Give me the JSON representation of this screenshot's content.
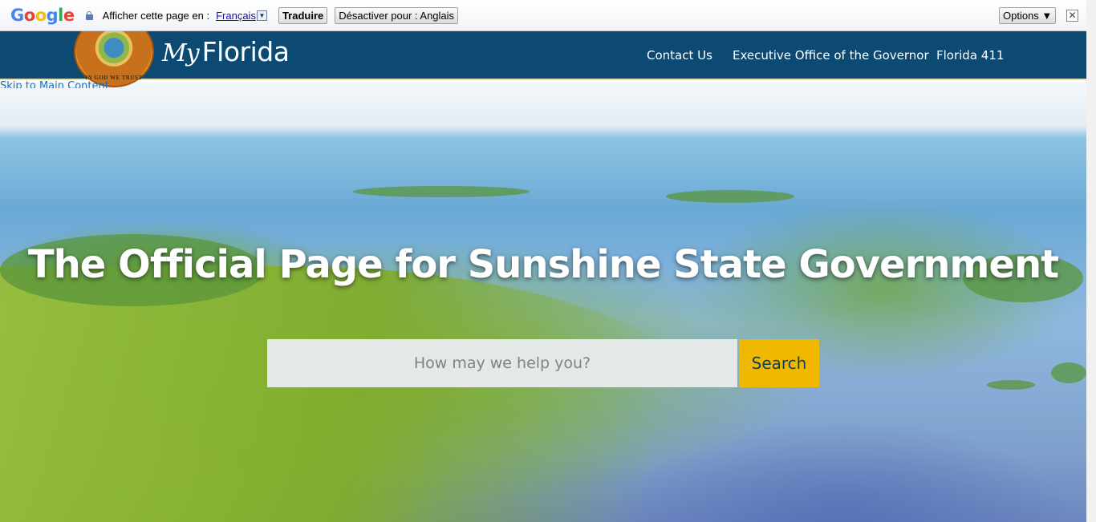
{
  "translate_bar": {
    "prompt": "Afficher cette page en :",
    "language": "Français",
    "language_arrow": "▼",
    "translate_button": "Traduire",
    "disable_button": "Désactiver pour : Anglais",
    "options_button": "Options ▼",
    "close_glyph": "✕",
    "google_logo": [
      "G",
      "o",
      "o",
      "g",
      "l",
      "e"
    ]
  },
  "header": {
    "brand_my": "My",
    "brand_name": "Florida",
    "seal_motto": "IN GOD WE TRUST",
    "nav": [
      "Contact Us",
      "Executive Office of the Governor",
      "Florida 411"
    ]
  },
  "skip_link": "Skip to Main Content",
  "hero": {
    "title": "The Official Page for Sunshine State Government",
    "search_placeholder": "How may we help you?",
    "search_button": "Search"
  },
  "colors": {
    "header_bg": "#0c4a73",
    "search_button_bg": "#f0b800",
    "search_input_bg": "#e4e8e7"
  },
  "icons": [
    "lock-icon",
    "dropdown-arrow-icon",
    "close-icon",
    "florida-seal-icon"
  ]
}
